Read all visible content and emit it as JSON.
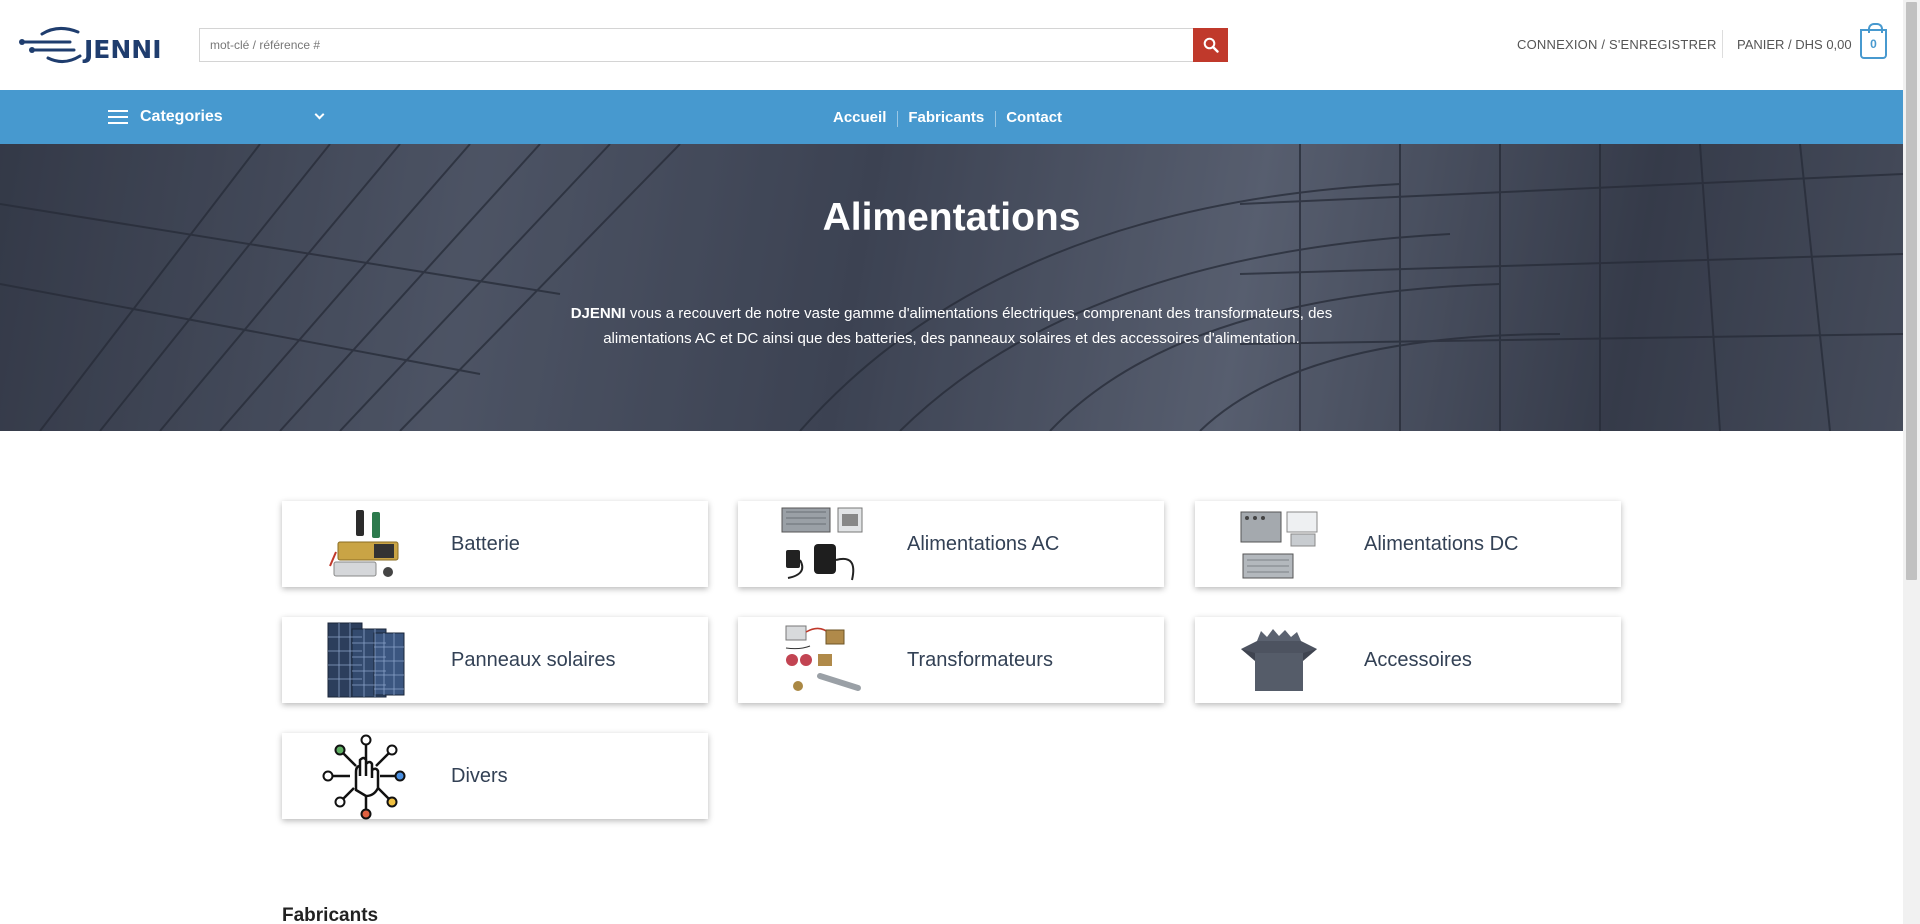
{
  "header": {
    "logo_text": "JENNI",
    "search_placeholder": "mot-clé / référence #",
    "account_label": "CONNEXION / S'ENREGISTRER",
    "cart_label": "PANIER / DHS 0,00",
    "cart_count": "0"
  },
  "nav": {
    "categories_label": "Categories",
    "menu": [
      "Accueil",
      "Fabricants",
      "Contact"
    ]
  },
  "hero": {
    "title": "Alimentations",
    "brand": "DJENNI",
    "text": " vous a recouvert de notre vaste gamme d'alimentations électriques, comprenant des transformateurs, des alimentations AC et DC ainsi que des batteries, des panneaux solaires et des accessoires d'alimentation."
  },
  "categories": [
    {
      "label": "Batterie",
      "icon": "battery-icon"
    },
    {
      "label": "Alimentations AC",
      "icon": "ac-power-supply-icon"
    },
    {
      "label": "Alimentations DC",
      "icon": "dc-power-supply-icon"
    },
    {
      "label": "Panneaux solaires",
      "icon": "solar-panel-icon"
    },
    {
      "label": "Transformateurs",
      "icon": "transformer-icon"
    },
    {
      "label": "Accessoires",
      "icon": "accessories-box-icon"
    },
    {
      "label": "Divers",
      "icon": "network-hand-icon"
    }
  ],
  "section": {
    "fabricants_title": "Fabricants"
  },
  "colors": {
    "nav_blue": "#4799cf",
    "search_red": "#c0392b",
    "logo_navy": "#1f3d6e"
  }
}
